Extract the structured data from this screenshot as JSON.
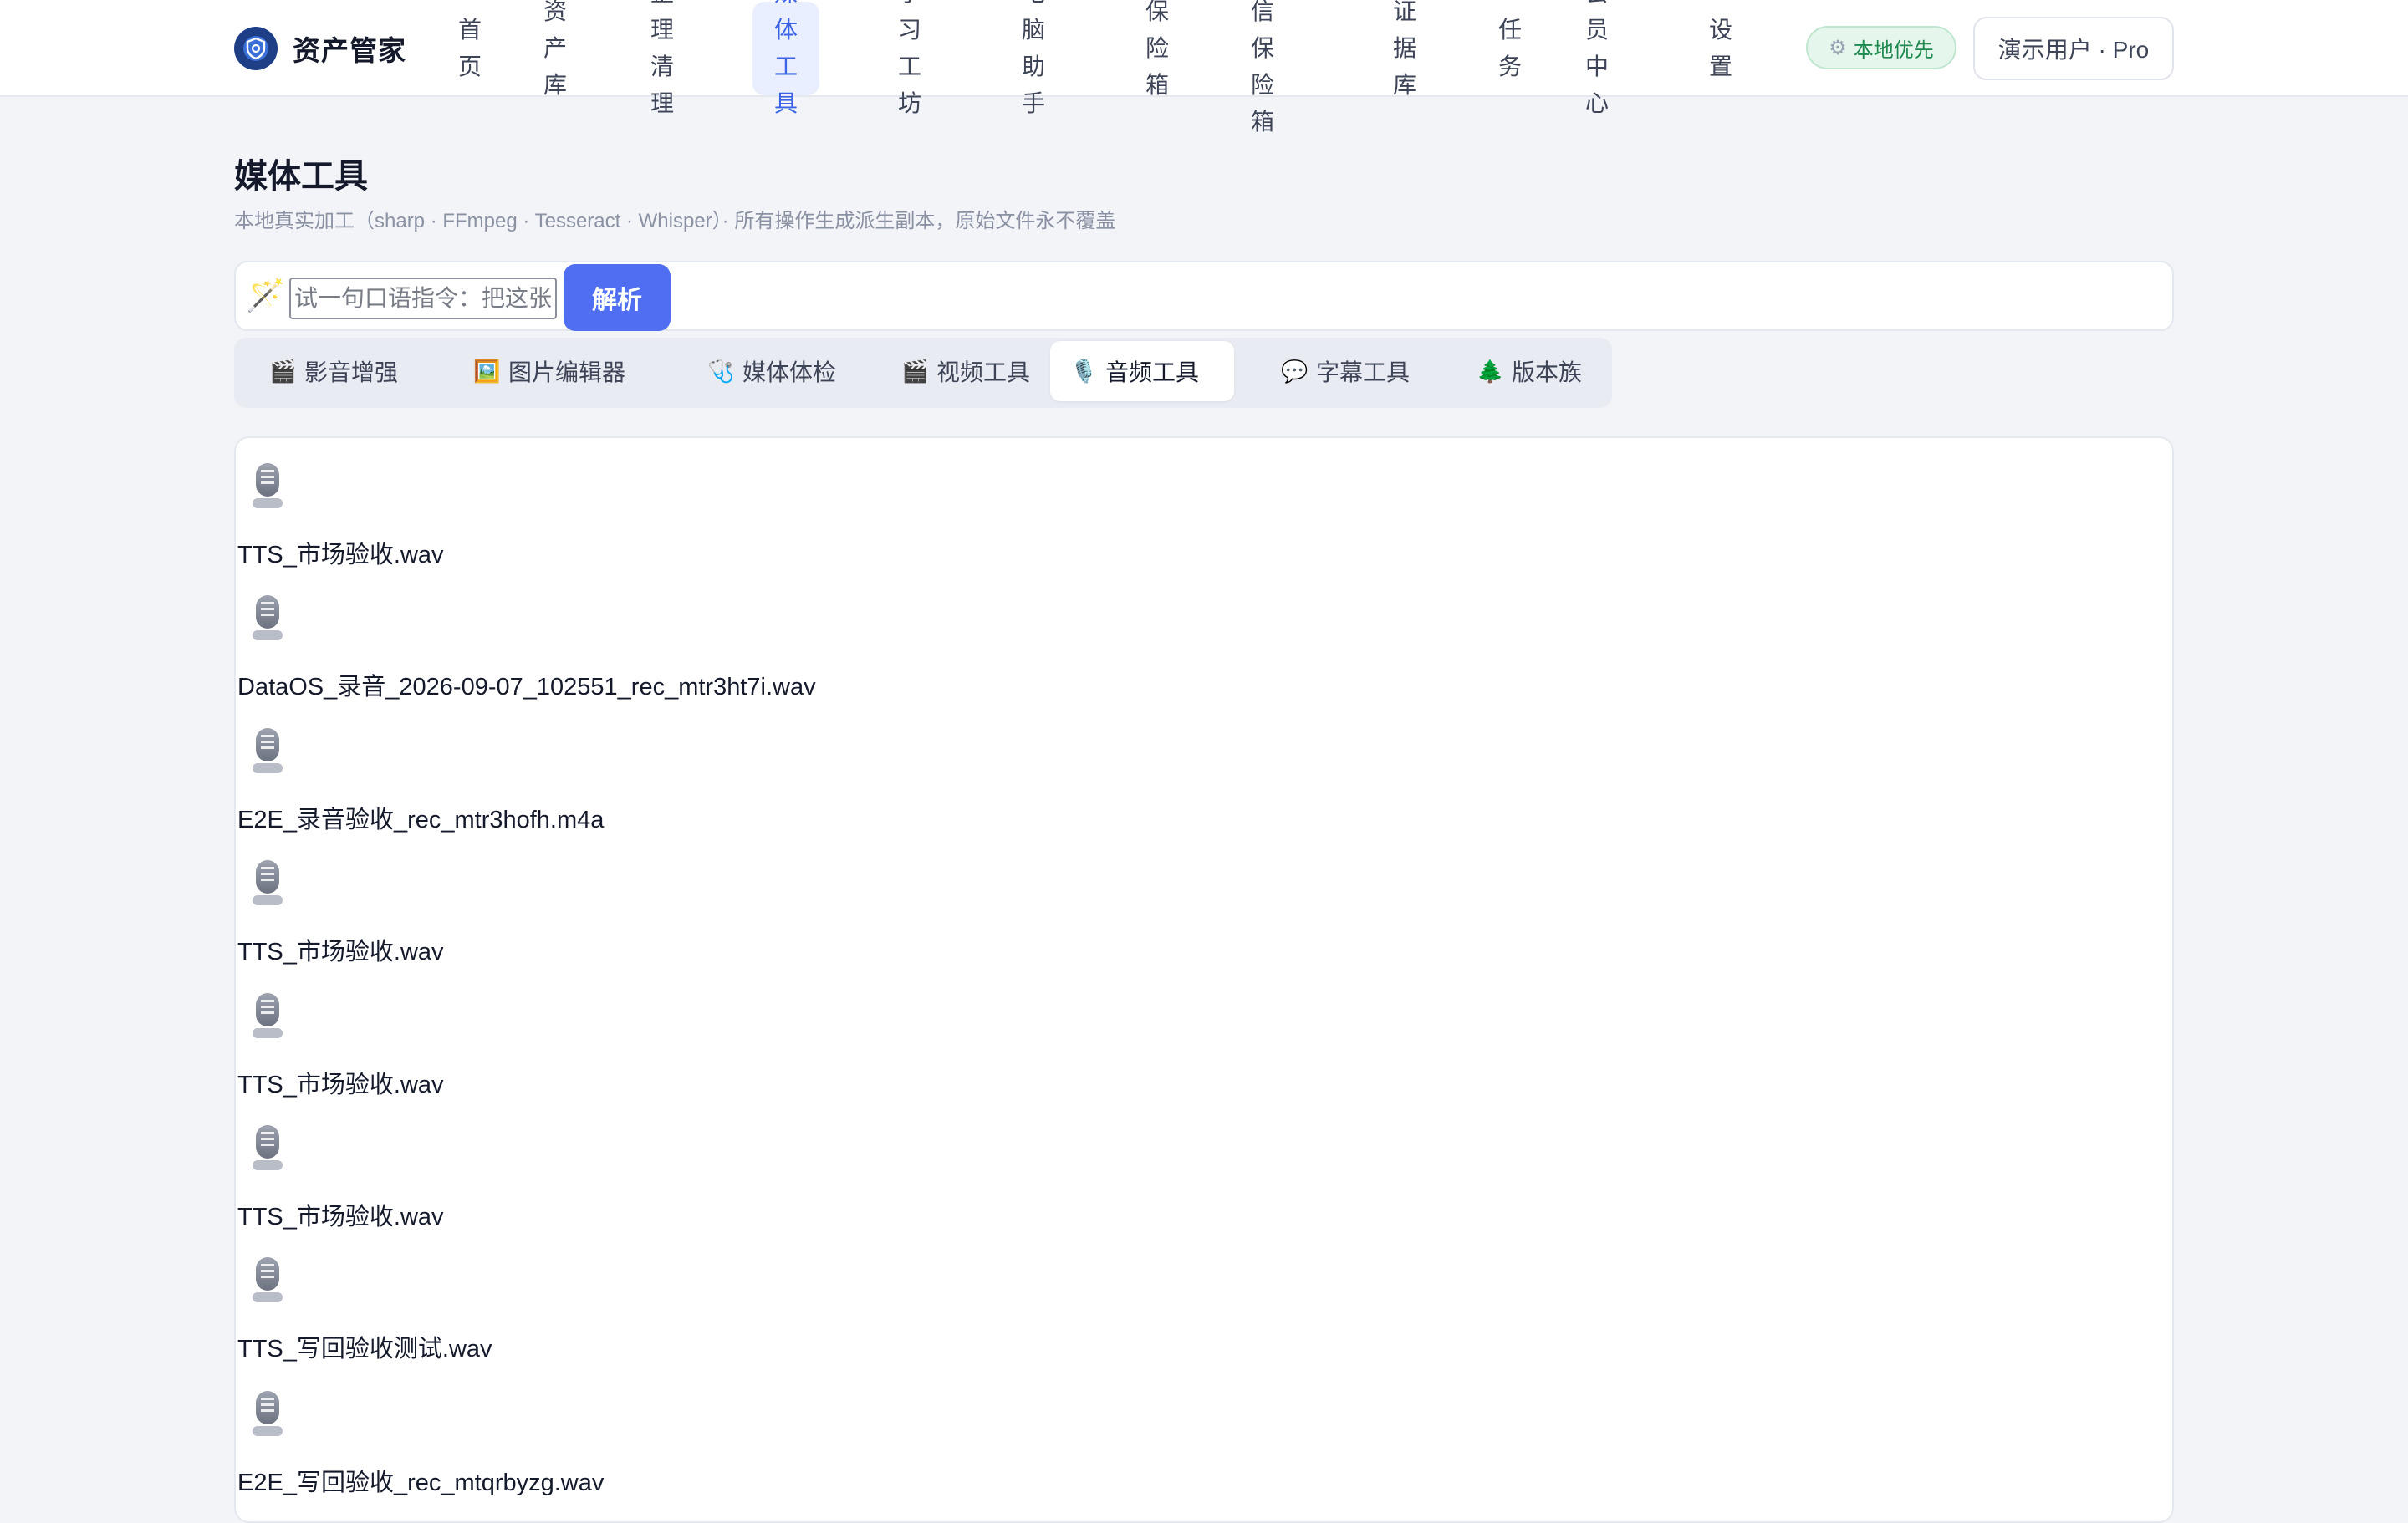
{
  "app": {
    "name": "资产管家"
  },
  "nav": {
    "items": [
      {
        "lines": [
          "首",
          "页"
        ]
      },
      {
        "lines": [
          "资产",
          "库"
        ]
      },
      {
        "lines": [
          "整理清",
          "理"
        ]
      },
      {
        "lines": [
          "媒体工",
          "具"
        ]
      },
      {
        "lines": [
          "学习工",
          "坊"
        ]
      },
      {
        "lines": [
          "电脑助",
          "手"
        ]
      },
      {
        "lines": [
          "保险",
          "箱"
        ]
      },
      {
        "lines": [
          "微信保",
          "险箱"
        ]
      },
      {
        "lines": [
          "证据",
          "库"
        ]
      },
      {
        "lines": [
          "任",
          "务"
        ]
      },
      {
        "lines": [
          "会员中",
          "心"
        ]
      },
      {
        "lines": [
          "设",
          "置"
        ]
      }
    ],
    "active_index": 3
  },
  "header": {
    "local_badge": "本地优先",
    "local_badge_icon": "gear-icon",
    "user_label": "演示用户 · Pro"
  },
  "page": {
    "title": "媒体工具",
    "subtitle": "本地真实加工（sharp · FFmpeg · Tesseract · Whisper）· 所有操作生成派生副本，原始文件永不覆盖"
  },
  "command": {
    "icon": "magic-wand-icon",
    "placeholder": "试一句口语指令：把这张",
    "value": "",
    "submit_label": "解析",
    "accent": "#4f6ef2"
  },
  "tabs": [
    {
      "label": "影音增强",
      "icon": "🎬"
    },
    {
      "label": "图片编辑器",
      "icon": "🖼️"
    },
    {
      "label": "媒体体检",
      "icon": "🩺"
    },
    {
      "label": "视频工具",
      "icon": "🎬"
    },
    {
      "label": "音频工具",
      "icon": "🎙️"
    },
    {
      "label": "字幕工具",
      "icon": "💬"
    },
    {
      "label": "版本族",
      "icon": "🌲"
    }
  ],
  "active_tab": 4,
  "files": [
    {
      "name": "TTS_市场验收.wav",
      "icon": "microphone-icon"
    },
    {
      "name": "DataOS_录音_2026-09-07_102551_rec_mtr3ht7i.wav",
      "icon": "microphone-icon"
    },
    {
      "name": "E2E_录音验收_rec_mtr3hofh.m4a",
      "icon": "microphone-icon"
    },
    {
      "name": "TTS_市场验收.wav",
      "icon": "microphone-icon"
    },
    {
      "name": "TTS_市场验收.wav",
      "icon": "microphone-icon"
    },
    {
      "name": "TTS_市场验收.wav",
      "icon": "microphone-icon"
    },
    {
      "name": "TTS_写回验收测试.wav",
      "icon": "microphone-icon"
    },
    {
      "name": "E2E_写回验收_rec_mtqrbyzg.wav",
      "icon": "microphone-icon"
    }
  ]
}
